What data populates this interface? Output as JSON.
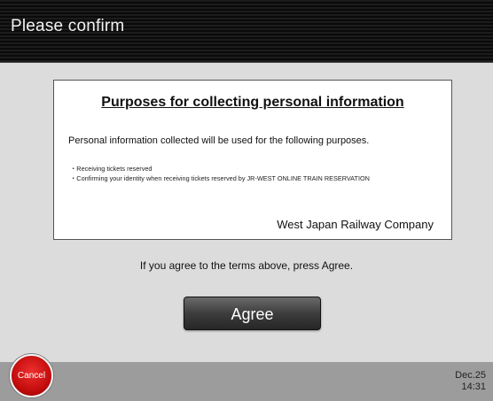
{
  "header": {
    "title": "Please confirm"
  },
  "notice": {
    "title": "Purposes for collecting personal information",
    "intro": "Personal information collected will be used for the following purposes.",
    "purposes": [
      "Receiving tickets reserved",
      "Confirming your identity when receiving tickets reserved by JR-WEST ONLINE TRAIN RESERVATION"
    ],
    "company": "West Japan Railway Company"
  },
  "instruction": "If you agree to the terms above, press Agree.",
  "buttons": {
    "agree_label": "Agree",
    "cancel_label": "Cancel"
  },
  "footer": {
    "date": "Dec.25",
    "time": "14:31"
  },
  "colors": {
    "header_bg": "#111111",
    "cancel": "#d41414",
    "footer_bg": "#9c9c9c",
    "page_bg": "#dcdcdc"
  }
}
